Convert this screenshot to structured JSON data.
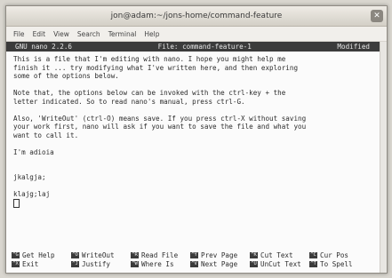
{
  "window": {
    "title": "jon@adam:~/jons-home/command-feature",
    "close_icon": "close-icon"
  },
  "menubar": [
    "File",
    "Edit",
    "View",
    "Search",
    "Terminal",
    "Help"
  ],
  "nano": {
    "version": "GNU nano 2.2.6",
    "file": "File: command-feature-1",
    "status": "Modified"
  },
  "body_lines": [
    "This is a file that I'm editing with nano. I hope you might help me",
    "finish it ... try modifying what I've written here, and then exploring",
    "some of the options below.",
    "",
    "Note that, the options below can be invoked with the ctrl-key + the",
    "letter indicated. So to read nano's manual, press ctrl-G.",
    "",
    "Also, 'WriteOut' (ctrl-O) means save. If you press ctrl-X without saving",
    "your work first, nano will ask if you want to save the file and what you",
    "want to call it.",
    "",
    "I'm adioia",
    "",
    "",
    "jkalgja;",
    "",
    "klajg;laj"
  ],
  "shortcuts": [
    [
      {
        "key": "^G",
        "label": "Get Help"
      },
      {
        "key": "^O",
        "label": "WriteOut"
      },
      {
        "key": "^R",
        "label": "Read File"
      },
      {
        "key": "^Y",
        "label": "Prev Page"
      },
      {
        "key": "^K",
        "label": "Cut Text"
      },
      {
        "key": "^C",
        "label": "Cur Pos"
      }
    ],
    [
      {
        "key": "^X",
        "label": "Exit"
      },
      {
        "key": "^J",
        "label": "Justify"
      },
      {
        "key": "^W",
        "label": "Where Is"
      },
      {
        "key": "^V",
        "label": "Next Page"
      },
      {
        "key": "^U",
        "label": "UnCut Text"
      },
      {
        "key": "^T",
        "label": "To Spell"
      }
    ]
  ]
}
